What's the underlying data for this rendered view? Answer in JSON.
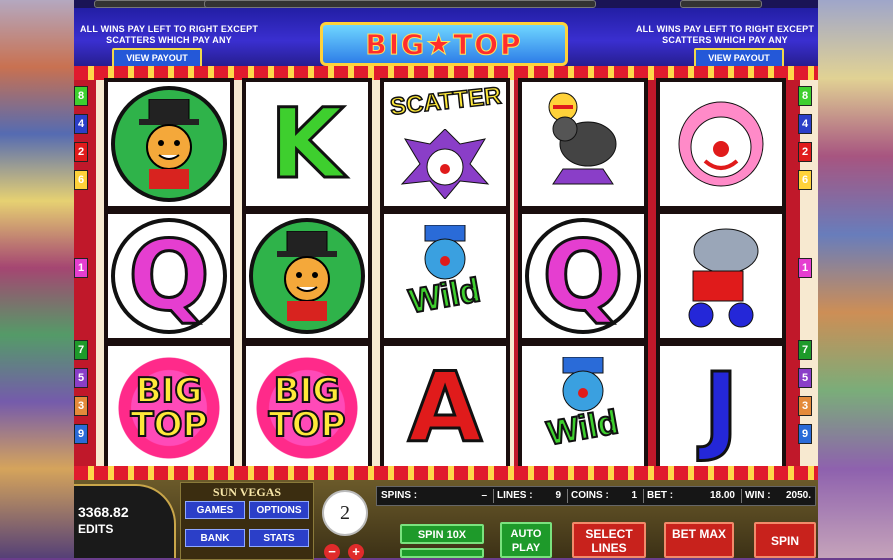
{
  "header": {
    "logo": "BIG★TOP",
    "pay_note_left": "ALL WINS PAY LEFT TO RIGHT EXCEPT SCATTERS WHICH PAY ANY",
    "pay_note_right": "ALL WINS PAY LEFT TO RIGHT EXCEPT SCATTERS WHICH PAY ANY",
    "view_payout_left": "VIEW PAYOUT",
    "view_payout_right": "VIEW PAYOUT"
  },
  "reels": [
    [
      "ringmaster-lion",
      "Q",
      "BIG TOP"
    ],
    [
      "K",
      "ringmaster-lion",
      "BIG TOP"
    ],
    [
      "SCATTER",
      "Wild",
      "A"
    ],
    [
      "seal",
      "Q",
      "Wild"
    ],
    [
      "clown",
      "elephant",
      "J"
    ]
  ],
  "symbol_text": {
    "big_top_1": "BIG",
    "big_top_2": "TOP",
    "scatter": "SCATTER",
    "wild": "Wild",
    "k": "K",
    "q": "Q",
    "a": "A",
    "j": "J"
  },
  "side_numbers_left": [
    "8",
    "4",
    "2",
    "6",
    "1",
    "7",
    "5",
    "3",
    "9"
  ],
  "side_numbers_right": [
    "8",
    "4",
    "2",
    "6",
    "1",
    "7",
    "5",
    "3",
    "9"
  ],
  "panel": {
    "credit_value": "3368.82",
    "credit_label": "EDITS",
    "casino_name": "SUN VEGAS",
    "menu": {
      "games": "GAMES",
      "options": "OPTIONS",
      "bank": "BANK",
      "stats": "STATS"
    },
    "coin_size": "2",
    "minus": "−",
    "plus": "+",
    "stats": {
      "spins_label": "SPINS :",
      "spins_value": "–",
      "lines_label": "LINES :",
      "lines_value": "9",
      "coins_label": "COINS :",
      "coins_value": "1",
      "bet_label": "BET :",
      "bet_value": "18.00",
      "win_label": "WIN :",
      "win_value": "2050."
    },
    "buttons": {
      "spin10x": "SPIN 10X",
      "spin10x_b": "",
      "auto_play": "AUTO PLAY",
      "select_lines": "SELECT LINES",
      "bet_max": "BET MAX",
      "spin": "SPIN"
    }
  },
  "colors": {
    "red_stripe": "#c0182a",
    "cream_stripe": "#f7e9d0",
    "button_green": "#1e9a2a",
    "button_red": "#c8221c",
    "menu_blue": "#2b3fc8"
  }
}
